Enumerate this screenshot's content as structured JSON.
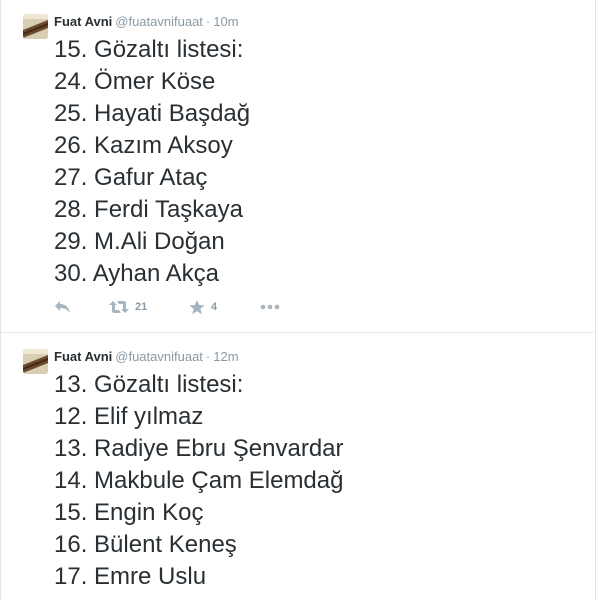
{
  "tweets": [
    {
      "author": {
        "fullname": "Fuat Avni",
        "username": "@fuatavnifuaat"
      },
      "separator": "·",
      "time": "10m",
      "lines": [
        "15. Gözaltı listesi:",
        "24. Ömer Köse",
        "25. Hayati Başdağ",
        "26. Kazım Aksoy",
        "27. Gafur Ataç",
        "28. Ferdi Taşkaya",
        "29. M.Ali Doğan",
        "30. Ayhan Akça"
      ],
      "actions": {
        "reply_icon": "reply-icon",
        "retweet_icon": "retweet-icon",
        "retweet_count": "21",
        "favorite_icon": "star-icon",
        "favorite_count": "4",
        "more_icon": "more-dots-icon"
      }
    },
    {
      "author": {
        "fullname": "Fuat Avni",
        "username": "@fuatavnifuaat"
      },
      "separator": "·",
      "time": "12m",
      "lines": [
        "13. Gözaltı listesi:",
        "12. Elif yılmaz",
        "13. Radiye Ebru Şenvardar",
        "14. Makbule Çam Elemdağ",
        "15. Engin Koç",
        "16. Bülent Keneş",
        "17. Emre Uslu"
      ]
    }
  ],
  "colors": {
    "text": "#292f33",
    "secondary": "#8899a6",
    "icon": "#a7b4bd",
    "divider": "#e1e8ed"
  }
}
